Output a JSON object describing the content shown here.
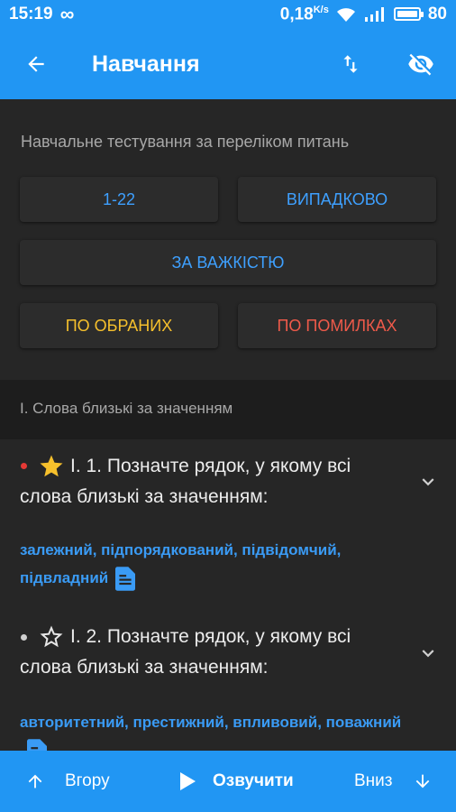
{
  "status_bar": {
    "time": "15:19",
    "infinity": "∞",
    "speed": "0,18",
    "speed_unit": "K/s",
    "battery": "80"
  },
  "app_bar": {
    "title": "Навчання"
  },
  "testing": {
    "heading": "Навчальне тестування за переліком питань",
    "buttons": {
      "range": "1-22",
      "random": "ВИПАДКОВО",
      "difficulty": "ЗА ВАЖКІСТЮ",
      "favorites": "ПО ОБРАНИХ",
      "mistakes": "ПО ПОМИЛКАХ"
    }
  },
  "category": {
    "title": "I. Слова близькі за значенням"
  },
  "questions": [
    {
      "text": "I. 1. Позначте рядок, у якому всі слова близькі за значенням:",
      "answer": "залежний, підпорядкований, підвідомчий, підвладний",
      "starred": true,
      "dot_color": "#e53935"
    },
    {
      "text": "I. 2. Позначте рядок, у якому всі слова близькі за значенням:",
      "answer": "авторитетний, престижний, впливовий, поважний",
      "starred": false,
      "dot_color": "#cfcfcf"
    }
  ],
  "bottom_bar": {
    "up": "Вгору",
    "speak": "Озвучити",
    "down": "Вниз"
  },
  "colors": {
    "accent": "#2196f3",
    "link": "#3a9bf5",
    "favorites": "#f6c02c",
    "mistakes": "#ef5a4a",
    "background": "#262626"
  }
}
